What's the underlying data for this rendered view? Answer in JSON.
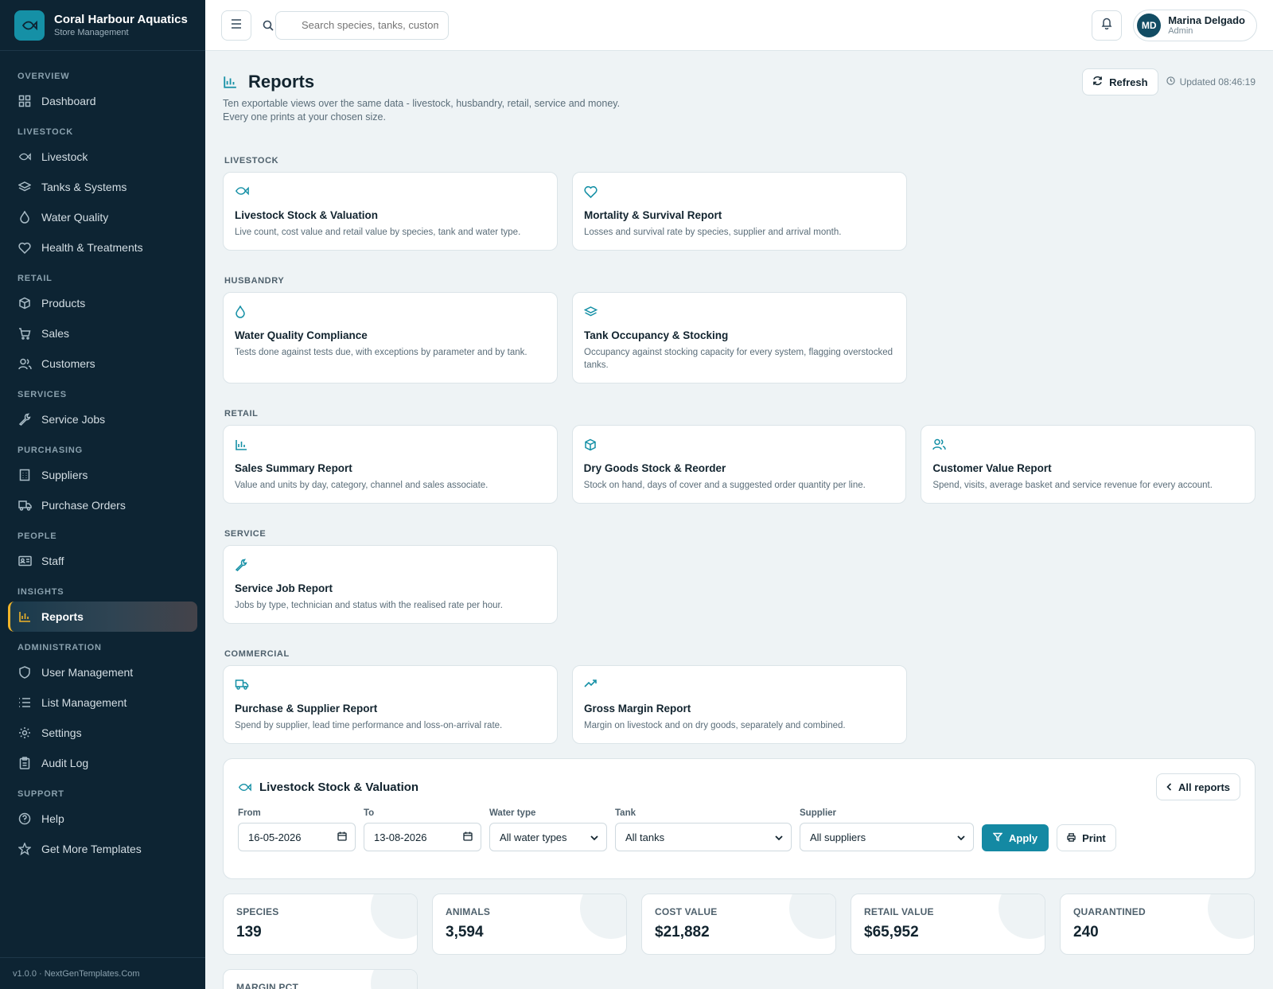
{
  "brand": {
    "title": "Coral Harbour Aquatics",
    "subtitle": "Store Management"
  },
  "nav": {
    "overview": "OVERVIEW",
    "dashboard": "Dashboard",
    "livestock_section": "LIVESTOCK",
    "livestock": "Livestock",
    "tanks": "Tanks & Systems",
    "water": "Water Quality",
    "health": "Health & Treatments",
    "retail_section": "RETAIL",
    "products": "Products",
    "sales": "Sales",
    "customers": "Customers",
    "services_section": "SERVICES",
    "service_jobs": "Service Jobs",
    "purchasing_section": "PURCHASING",
    "suppliers": "Suppliers",
    "purchase_orders": "Purchase Orders",
    "people_section": "PEOPLE",
    "staff": "Staff",
    "insights_section": "INSIGHTS",
    "reports": "Reports",
    "admin_section": "ADMINISTRATION",
    "user_mgmt": "User Management",
    "list_mgmt": "List Management",
    "settings": "Settings",
    "audit": "Audit Log",
    "support_section": "SUPPORT",
    "help": "Help",
    "templates": "Get More Templates"
  },
  "footer": "v1.0.0 · NextGenTemplates.Com",
  "topbar": {
    "search_placeholder": "Search species, tanks, customers",
    "user_name": "Marina Delgado",
    "user_role": "Admin",
    "initials": "MD"
  },
  "page": {
    "title": "Reports",
    "desc1": "Ten exportable views over the same data - livestock, husbandry, retail, service and money.",
    "desc2": "Every one prints at your chosen size.",
    "refresh": "Refresh",
    "updated": "Updated 08:46:19"
  },
  "groups": {
    "livestock": "LIVESTOCK",
    "husbandry": "HUSBANDRY",
    "retail": "RETAIL",
    "service": "SERVICE",
    "commercial": "COMMERCIAL"
  },
  "cards": {
    "stock": {
      "title": "Livestock Stock & Valuation",
      "desc": "Live count, cost value and retail value by species, tank and water type."
    },
    "mortality": {
      "title": "Mortality & Survival Report",
      "desc": "Losses and survival rate by species, supplier and arrival month."
    },
    "water": {
      "title": "Water Quality Compliance",
      "desc": "Tests done against tests due, with exceptions by parameter and by tank."
    },
    "tank": {
      "title": "Tank Occupancy & Stocking",
      "desc": "Occupancy against stocking capacity for every system, flagging overstocked tanks."
    },
    "sales": {
      "title": "Sales Summary Report",
      "desc": "Value and units by day, category, channel and sales associate."
    },
    "dry": {
      "title": "Dry Goods Stock & Reorder",
      "desc": "Stock on hand, days of cover and a suggested order quantity per line."
    },
    "customer": {
      "title": "Customer Value Report",
      "desc": "Spend, visits, average basket and service revenue for every account."
    },
    "service": {
      "title": "Service Job Report",
      "desc": "Jobs by type, technician and status with the realised rate per hour."
    },
    "purchase": {
      "title": "Purchase & Supplier Report",
      "desc": "Spend by supplier, lead time performance and loss-on-arrival rate."
    },
    "margin": {
      "title": "Gross Margin Report",
      "desc": "Margin on livestock and on dry goods, separately and combined."
    }
  },
  "panel": {
    "title": "Livestock Stock & Valuation",
    "all_reports": "All reports",
    "from_label": "From",
    "from_value": "16-05-2026",
    "to_label": "To",
    "to_value": "13-08-2026",
    "water_label": "Water type",
    "water_value": "All water types",
    "tank_label": "Tank",
    "tank_value": "All tanks",
    "supplier_label": "Supplier",
    "supplier_value": "All suppliers",
    "apply": "Apply",
    "print": "Print"
  },
  "kpis": {
    "species_label": "SPECIES",
    "species_value": "139",
    "animals_label": "ANIMALS",
    "animals_value": "3,594",
    "cost_label": "COST VALUE",
    "cost_value": "$21,882",
    "retail_label": "RETAIL VALUE",
    "retail_value": "$65,952",
    "quar_label": "QUARANTINED",
    "quar_value": "240",
    "margin_label": "MARGIN PCT"
  },
  "colors": {
    "sidebar": "#0d2433",
    "accent": "#1590a6",
    "active_marker": "#f0b429",
    "background": "#eef3f5"
  }
}
